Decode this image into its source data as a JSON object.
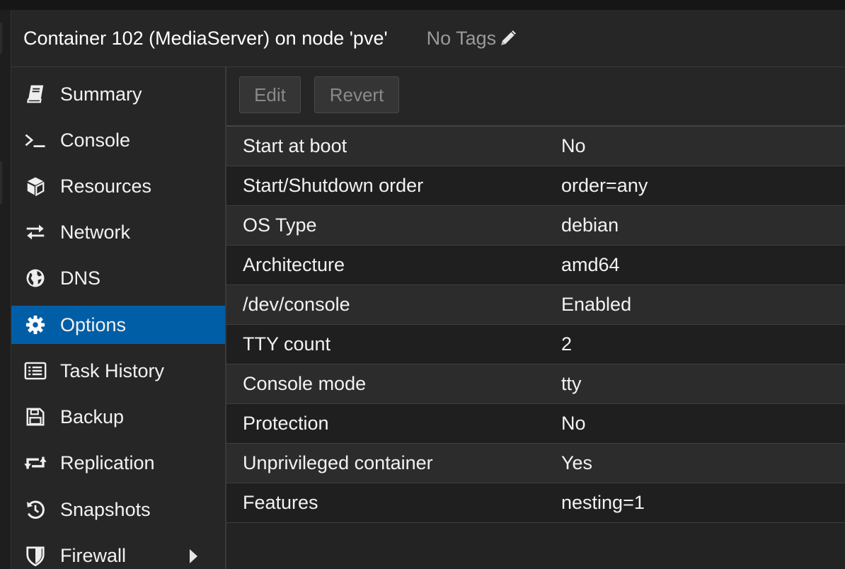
{
  "header": {
    "title": "Container 102 (MediaServer) on node 'pve'",
    "tags_label": "No Tags",
    "tags_icon": "pencil-icon"
  },
  "sidebar": {
    "items": [
      {
        "label": "Summary",
        "icon": "book-icon",
        "active": false
      },
      {
        "label": "Console",
        "icon": "terminal-icon",
        "active": false
      },
      {
        "label": "Resources",
        "icon": "cube-icon",
        "active": false
      },
      {
        "label": "Network",
        "icon": "exchange-icon",
        "active": false
      },
      {
        "label": "DNS",
        "icon": "globe-icon",
        "active": false
      },
      {
        "label": "Options",
        "icon": "gear-icon",
        "active": true
      },
      {
        "label": "Task History",
        "icon": "list-icon",
        "active": false
      },
      {
        "label": "Backup",
        "icon": "floppy-icon",
        "active": false
      },
      {
        "label": "Replication",
        "icon": "retweet-icon",
        "active": false
      },
      {
        "label": "Snapshots",
        "icon": "history-icon",
        "active": false
      },
      {
        "label": "Firewall",
        "icon": "shield-icon",
        "active": false,
        "has_submenu": true
      }
    ]
  },
  "toolbar": {
    "edit_label": "Edit",
    "revert_label": "Revert"
  },
  "options": {
    "rows": [
      {
        "key": "Start at boot",
        "value": "No"
      },
      {
        "key": "Start/Shutdown order",
        "value": "order=any"
      },
      {
        "key": "OS Type",
        "value": "debian"
      },
      {
        "key": "Architecture",
        "value": "amd64"
      },
      {
        "key": "/dev/console",
        "value": "Enabled"
      },
      {
        "key": "TTY count",
        "value": "2"
      },
      {
        "key": "Console mode",
        "value": "tty"
      },
      {
        "key": "Protection",
        "value": "No"
      },
      {
        "key": "Unprivileged container",
        "value": "Yes"
      },
      {
        "key": "Features",
        "value": "nesting=1"
      }
    ]
  },
  "colors": {
    "accent": "#005ea6",
    "background": "#1b1b1b",
    "panel": "#262626",
    "text": "#f2f2f2",
    "muted": "#9a9a9a"
  }
}
